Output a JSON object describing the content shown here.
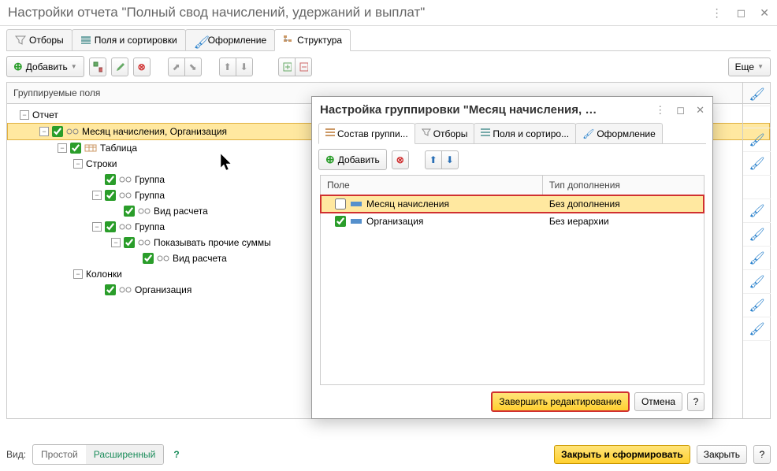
{
  "window": {
    "title": "Настройки отчета \"Полный свод начислений, удержаний и выплат\""
  },
  "mainTabs": [
    {
      "label": "Отборы",
      "icon": "filter"
    },
    {
      "label": "Поля и сортировки",
      "icon": "fields"
    },
    {
      "label": "Оформление",
      "icon": "brush"
    },
    {
      "label": "Структура",
      "icon": "structure",
      "active": true
    }
  ],
  "toolbar": {
    "add": "Добавить",
    "more": "Еще"
  },
  "treeHeader": "Группируемые поля",
  "tree": {
    "root": "Отчет",
    "n1": "Месяц начисления, Организация",
    "n2": "Таблица",
    "n3": "Строки",
    "n4": "Группа",
    "n5": "Группа",
    "n6": "Вид расчета",
    "n7": "Группа",
    "n8": "Показывать прочие суммы",
    "n9": "Вид расчета",
    "n10": "Колонки",
    "n11": "Организация"
  },
  "popup": {
    "title": "Настройка группировки \"Месяц начисления, …",
    "tabs": [
      {
        "label": "Состав группи...",
        "icon": "fields",
        "active": true
      },
      {
        "label": "Отборы",
        "icon": "filter"
      },
      {
        "label": "Поля и сортиро...",
        "icon": "fields"
      },
      {
        "label": "Оформление",
        "icon": "brush"
      }
    ],
    "add": "Добавить",
    "thField": "Поле",
    "thType": "Тип дополнения",
    "rows": [
      {
        "field": "Месяц начисления",
        "type": "Без дополнения",
        "checked": false,
        "hl": true
      },
      {
        "field": "Организация",
        "type": "Без иерархии",
        "checked": true,
        "hl": false
      }
    ],
    "finish": "Завершить редактирование",
    "cancel": "Отмена"
  },
  "bottom": {
    "view": "Вид:",
    "simple": "Простой",
    "advanced": "Расширенный",
    "closeAndBuild": "Закрыть и сформировать",
    "close": "Закрыть"
  }
}
